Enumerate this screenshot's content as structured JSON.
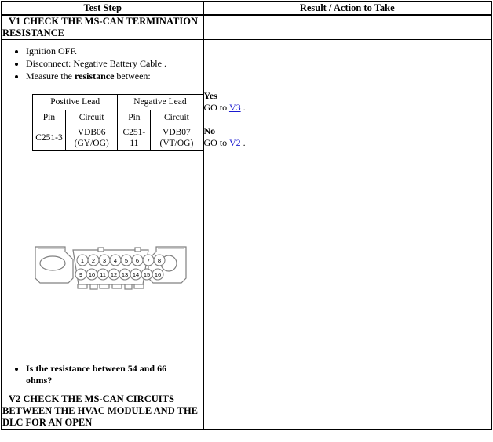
{
  "table": {
    "headers": {
      "step": "Test Step",
      "result": "Result / Action to Take"
    }
  },
  "v1": {
    "title": "V1 CHECK THE MS-CAN TERMINATION RESISTANCE",
    "steps": [
      "Ignition OFF.",
      "Disconnect: Negative Battery Cable .",
      "Measure the resistance between:"
    ],
    "step3_prefix": "Measure the ",
    "step3_bold": "resistance",
    "step3_suffix": " between:",
    "lead_table": {
      "group_headers": [
        "Positive Lead",
        "Negative Lead"
      ],
      "column_headers": [
        "Pin",
        "Circuit",
        "Pin",
        "Circuit"
      ],
      "rows": [
        [
          "C251-3",
          "VDB06 (GY/OG)",
          "C251-11",
          "VDB07 (VT/OG)"
        ]
      ],
      "cells": {
        "pos_pin": "C251-3",
        "pos_circuit_line1": "VDB06",
        "pos_circuit_line2": "(GY/OG)",
        "neg_pin": "C251-11",
        "neg_circuit_line1": "VDB07",
        "neg_circuit_line2": "(VT/OG)"
      }
    },
    "connector": {
      "name": "dlc-16-pin-connector",
      "top_row_pins": [
        "1",
        "2",
        "3",
        "4",
        "5",
        "6",
        "7",
        "8"
      ],
      "bottom_row_pins": [
        "9",
        "10",
        "11",
        "12",
        "13",
        "14",
        "15",
        "16"
      ],
      "outline_color": "#808080",
      "fill_color": "#ffffff"
    },
    "question": "Is the resistance between 54 and 66 ohms?",
    "result": {
      "yes_label": "Yes",
      "yes_prefix": "GO to ",
      "yes_link": "V3",
      "yes_suffix": " .",
      "no_label": "No",
      "no_prefix": "GO to ",
      "no_link": "V2",
      "no_suffix": " ."
    }
  },
  "v2": {
    "title": "V2 CHECK THE MS-CAN CIRCUITS BETWEEN THE HVAC MODULE AND THE DLC FOR AN OPEN"
  },
  "colors": {
    "link": "#1a1ad0",
    "border": "#000000",
    "text": "#000000",
    "connector_stroke": "#808080"
  }
}
